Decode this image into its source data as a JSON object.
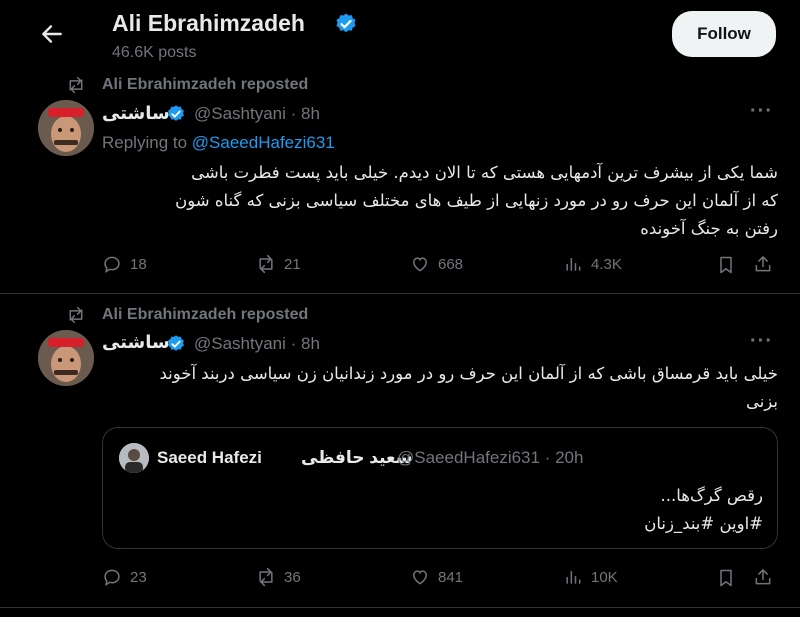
{
  "header": {
    "back_label": "←",
    "name": "Ali Ebrahimzadeh",
    "posts_count": "46.6K posts",
    "follow_label": "Follow"
  },
  "posts": [
    {
      "repost_label": "Ali Ebrahimzadeh reposted",
      "display_name": "ساشتی",
      "handle_time": "@Sashtyani · 8h",
      "replying_prefix": "Replying to",
      "replying_mention": "@SaeedHafezi631",
      "text_lines": [
        "شما یکی از بیشرف ترین آدمهایی هستی که تا الان دیدم. خیلی باید پست فطرت باشی",
        "که از آلمان این حرف رو در مورد زنهایی از طیف های مختلف سیاسی بزنی که گناه شون",
        "رفتن به جنگ آخونده"
      ],
      "stats": {
        "replies": "18",
        "reposts": "21",
        "likes": "668",
        "views": "4.3K"
      }
    },
    {
      "repost_label": "Ali Ebrahimzadeh reposted",
      "display_name": "ساشتی",
      "handle_time": "@Sashtyani · 8h",
      "text_lines": [
        "خیلی باید قرمساق باشی که از آلمان این حرف رو در مورد زندانیان زن سیاسی دربند آخوند",
        "بزنی"
      ],
      "quote": {
        "name": "Saeed Hafezi",
        "name_fa": "سعید حافظی",
        "handle_time": "@SaeedHafezi631 · 20h",
        "text_lines": [
          "رقص گرگ‌ها...",
          "#اوین #بند_زنان"
        ]
      },
      "stats": {
        "replies": "23",
        "reposts": "36",
        "likes": "841",
        "views": "10K"
      }
    }
  ],
  "colors": {
    "background": "#000000",
    "accent": "#1d9bf0",
    "muted": "#71767b",
    "text": "#e7e9ea",
    "border": "#2f3336"
  },
  "icons": [
    "back-arrow-icon",
    "verified-badge-icon",
    "repost-icon",
    "more-icon",
    "reply-icon",
    "like-icon",
    "views-icon",
    "bookmark-icon",
    "share-icon"
  ]
}
